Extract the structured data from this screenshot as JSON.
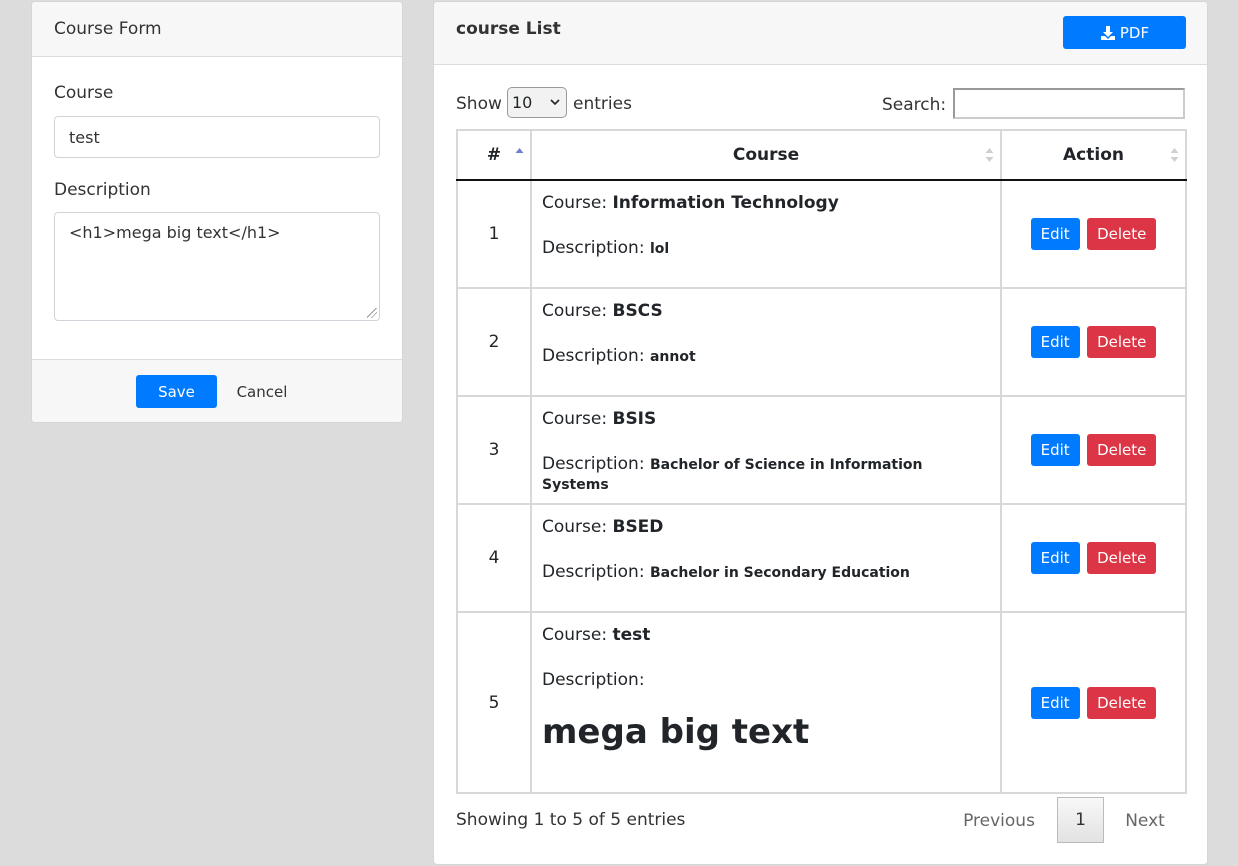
{
  "form": {
    "title": "Course Form",
    "course_label": "Course",
    "course_value": "test",
    "description_label": "Description",
    "description_value": "<h1>mega big text</h1>",
    "save_label": "Save",
    "cancel_label": "Cancel"
  },
  "list": {
    "title": "course List",
    "pdf_label": "PDF",
    "show_label": "Show",
    "entries_value": "10",
    "entries_label": "entries",
    "search_label": "Search:",
    "columns": [
      "#",
      "Course",
      "Action"
    ],
    "course_prefix": "Course:",
    "description_prefix": "Description:",
    "rows": [
      {
        "num": "1",
        "course": "Information Technology",
        "description": "lol"
      },
      {
        "num": "2",
        "course": "BSCS",
        "description": "annot"
      },
      {
        "num": "3",
        "course": "BSIS",
        "description": "Bachelor of Science in Information Systems"
      },
      {
        "num": "4",
        "course": "BSED",
        "description": "Bachelor in Secondary Education"
      },
      {
        "num": "5",
        "course": "test",
        "description": "",
        "description_rendered": "mega big text"
      }
    ],
    "edit_label": "Edit",
    "delete_label": "Delete",
    "info": "Showing 1 to 5 of 5 entries",
    "prev_label": "Previous",
    "page_label": "1",
    "next_label": "Next"
  },
  "colors": {
    "primary": "#007bff",
    "danger": "#dc3545",
    "background": "#dcdcdc"
  }
}
